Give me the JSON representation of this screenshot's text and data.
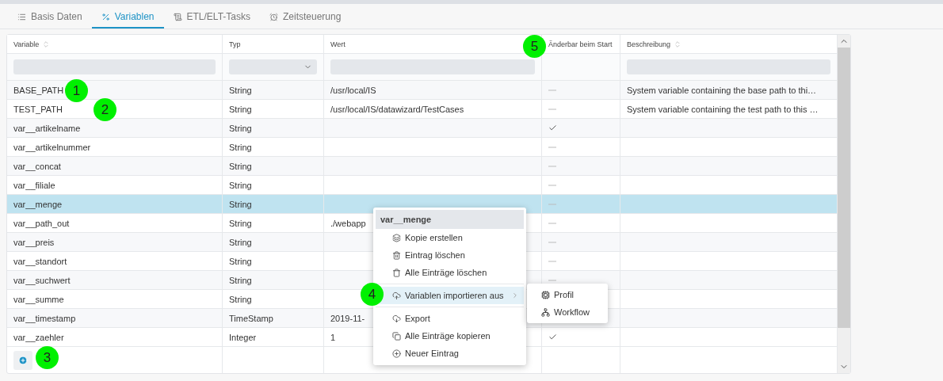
{
  "tabs": [
    {
      "label": "Basis Daten",
      "selected": false
    },
    {
      "label": "Variablen",
      "selected": true
    },
    {
      "label": "ETL/ELT-Tasks",
      "selected": false
    },
    {
      "label": "Zeitsteuerung",
      "selected": false
    }
  ],
  "table": {
    "columns": [
      {
        "label": "Variable",
        "sortable": true,
        "filter": {
          "kind": "text"
        }
      },
      {
        "label": "Typ",
        "sortable": false,
        "filter": {
          "kind": "select"
        }
      },
      {
        "label": "Wert",
        "sortable": false,
        "filter": {
          "kind": "text"
        }
      },
      {
        "label": "Änderbar beim Start",
        "sortable": false
      },
      {
        "label": "Beschreibung",
        "sortable": true,
        "filter": {
          "kind": "text"
        }
      }
    ],
    "rows": [
      {
        "variable": "BASE_PATH",
        "type": "String",
        "value": "/usr/local/IS",
        "changeable": false,
        "description": "System variable containing the base path to thi…",
        "selected": false
      },
      {
        "variable": "TEST_PATH",
        "type": "String",
        "value": "/usr/local/IS/datawizard/TestCases",
        "changeable": false,
        "description": "System variable containing the test path to this …",
        "selected": false
      },
      {
        "variable": "var__artikelname",
        "type": "String",
        "changeable": true,
        "selected": false
      },
      {
        "variable": "var__artikelnummer",
        "type": "String",
        "changeable": false,
        "selected": false
      },
      {
        "variable": "var__concat",
        "type": "String",
        "changeable": false,
        "selected": false
      },
      {
        "variable": "var__filiale",
        "type": "String",
        "changeable": false,
        "selected": false
      },
      {
        "variable": "var__menge",
        "type": "String",
        "changeable": false,
        "selected": true
      },
      {
        "variable": "var__path_out",
        "type": "String",
        "value": "./webapp",
        "changeable": false,
        "selected": false
      },
      {
        "variable": "var__preis",
        "type": "String",
        "changeable": false,
        "selected": false
      },
      {
        "variable": "var__standort",
        "type": "String",
        "changeable": false,
        "selected": false
      },
      {
        "variable": "var__suchwert",
        "type": "String",
        "changeable": false,
        "selected": false
      },
      {
        "variable": "var__summe",
        "type": "String",
        "selected": false
      },
      {
        "variable": "var__timestamp",
        "type": "TimeStamp",
        "value": "2019-11-",
        "selected": false
      },
      {
        "variable": "var__zaehler",
        "type": "Integer",
        "value": "1",
        "changeable": true,
        "selected": false
      }
    ]
  },
  "context_menu": {
    "title": "var__menge",
    "items": [
      {
        "kind": "item",
        "label": "Kopie erstellen",
        "selected": false
      },
      {
        "kind": "item",
        "label": "Eintrag löschen",
        "selected": false
      },
      {
        "kind": "item",
        "label": "Alle Einträge löschen",
        "selected": false
      },
      {
        "kind": "separator"
      },
      {
        "kind": "submenu",
        "label": "Variablen importieren aus",
        "selected": true
      },
      {
        "kind": "separator"
      },
      {
        "kind": "item",
        "label": "Export",
        "selected": false
      },
      {
        "kind": "item",
        "label": "Alle Einträge kopieren",
        "selected": false
      },
      {
        "kind": "item",
        "label": "Neuer Eintrag",
        "selected": false
      }
    ],
    "submenu": [
      {
        "label": "Profil"
      },
      {
        "label": "Workflow"
      }
    ]
  },
  "markers": [
    "1",
    "2",
    "3",
    "4",
    "5"
  ]
}
